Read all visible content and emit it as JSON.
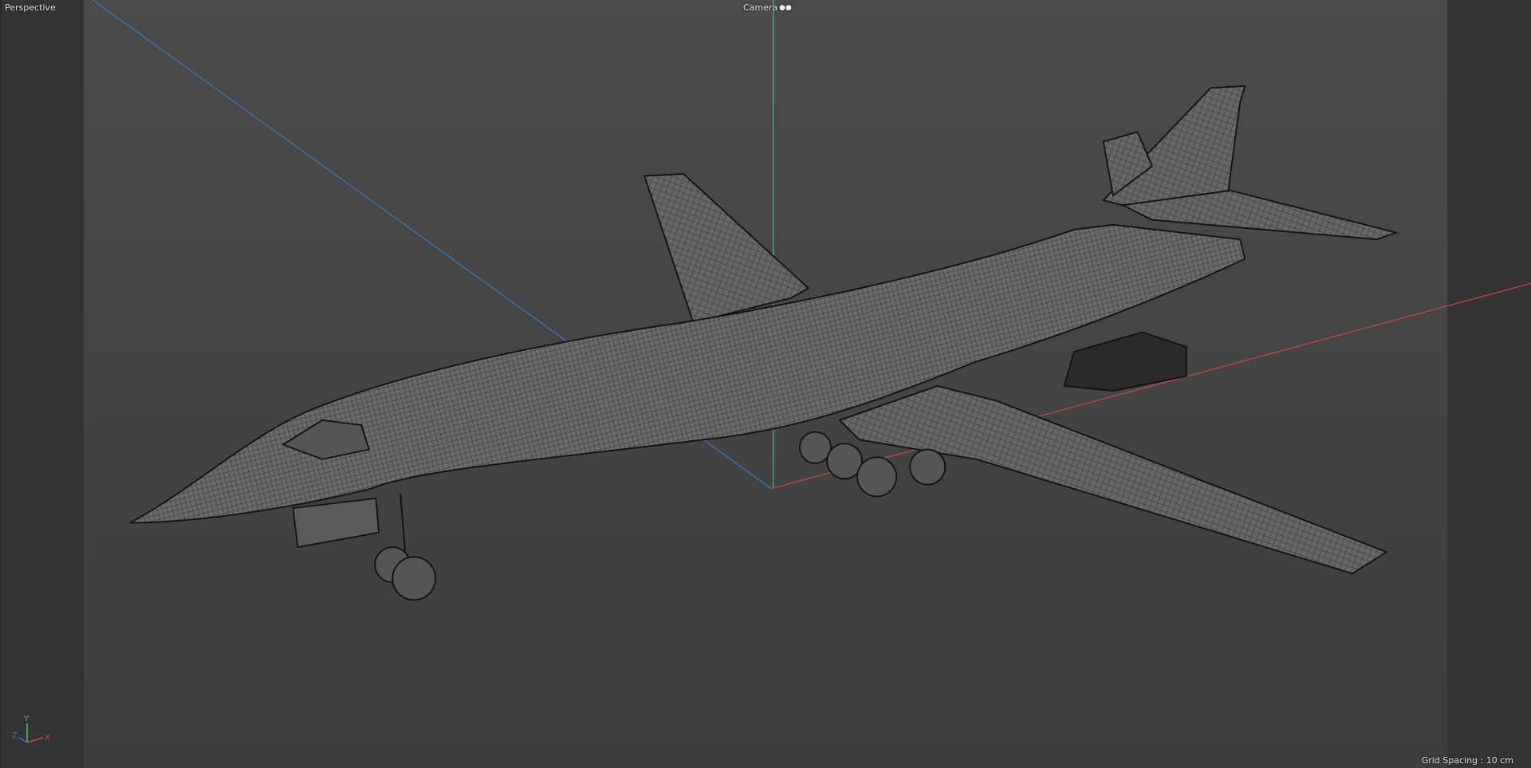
{
  "viewport": {
    "view_name": "Perspective",
    "camera_label": "Camera",
    "camera_icon": "camera-icon",
    "grid_spacing": "Grid Spacing : 10 cm",
    "axis_labels": {
      "x": "X",
      "y": "Y",
      "z": "Z"
    },
    "colors": {
      "x_axis": "#c8464b",
      "y_axis": "#3fbf7f",
      "z_axis": "#3a78c2",
      "background": "#474747"
    }
  }
}
